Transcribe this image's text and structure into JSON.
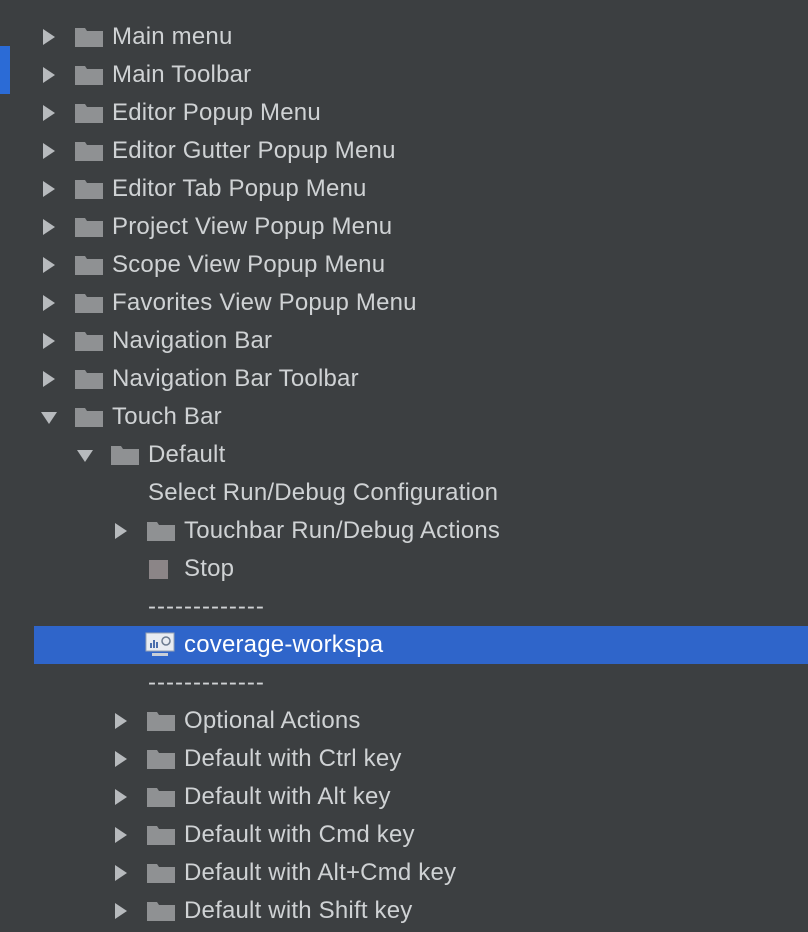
{
  "tree": {
    "rows": [
      {
        "label": "Main menu",
        "level": 0,
        "type": "folder",
        "expanded": false
      },
      {
        "label": "Main Toolbar",
        "level": 0,
        "type": "folder",
        "expanded": false
      },
      {
        "label": "Editor Popup Menu",
        "level": 0,
        "type": "folder",
        "expanded": false
      },
      {
        "label": "Editor Gutter Popup Menu",
        "level": 0,
        "type": "folder",
        "expanded": false
      },
      {
        "label": "Editor Tab Popup Menu",
        "level": 0,
        "type": "folder",
        "expanded": false
      },
      {
        "label": "Project View Popup Menu",
        "level": 0,
        "type": "folder",
        "expanded": false
      },
      {
        "label": "Scope View Popup Menu",
        "level": 0,
        "type": "folder",
        "expanded": false
      },
      {
        "label": "Favorites View Popup Menu",
        "level": 0,
        "type": "folder",
        "expanded": false
      },
      {
        "label": "Navigation Bar",
        "level": 0,
        "type": "folder",
        "expanded": false
      },
      {
        "label": "Navigation Bar Toolbar",
        "level": 0,
        "type": "folder",
        "expanded": false
      },
      {
        "label": "Touch Bar",
        "level": 0,
        "type": "folder",
        "expanded": true
      },
      {
        "label": "Default",
        "level": 1,
        "type": "folder",
        "expanded": true
      },
      {
        "label": "Select Run/Debug Configuration",
        "level": 2,
        "type": "action"
      },
      {
        "label": "Touchbar Run/Debug Actions",
        "level": 2,
        "type": "folder",
        "expanded": false
      },
      {
        "label": "Stop",
        "level": 2,
        "type": "stop"
      },
      {
        "label": "-------------",
        "level": 2,
        "type": "separator"
      },
      {
        "label": "coverage-workspa",
        "level": 2,
        "type": "target",
        "selected": true
      },
      {
        "label": "-------------",
        "level": 2,
        "type": "separator"
      },
      {
        "label": "Optional Actions",
        "level": 2,
        "type": "folder",
        "expanded": false
      },
      {
        "label": "Default with Ctrl key",
        "level": 2,
        "type": "folder",
        "expanded": false
      },
      {
        "label": "Default with Alt key",
        "level": 2,
        "type": "folder",
        "expanded": false
      },
      {
        "label": "Default with Cmd key",
        "level": 2,
        "type": "folder",
        "expanded": false
      },
      {
        "label": "Default with Alt+Cmd key",
        "level": 2,
        "type": "folder",
        "expanded": false
      },
      {
        "label": "Default with Shift key",
        "level": 2,
        "type": "folder",
        "expanded": false
      }
    ]
  },
  "colors": {
    "background": "#3c3f41",
    "text": "#cfd2d4",
    "selection": "#2f65ca",
    "accent": "#2b6bd6",
    "folder": "#8f9193",
    "arrow": "#b7babd",
    "stop": "#8b8587"
  },
  "icons": {
    "collapsed": "triangle-right-icon",
    "expanded": "triangle-down-icon",
    "folder": "folder-icon",
    "stop": "stop-icon",
    "target": "run-configuration-icon"
  }
}
